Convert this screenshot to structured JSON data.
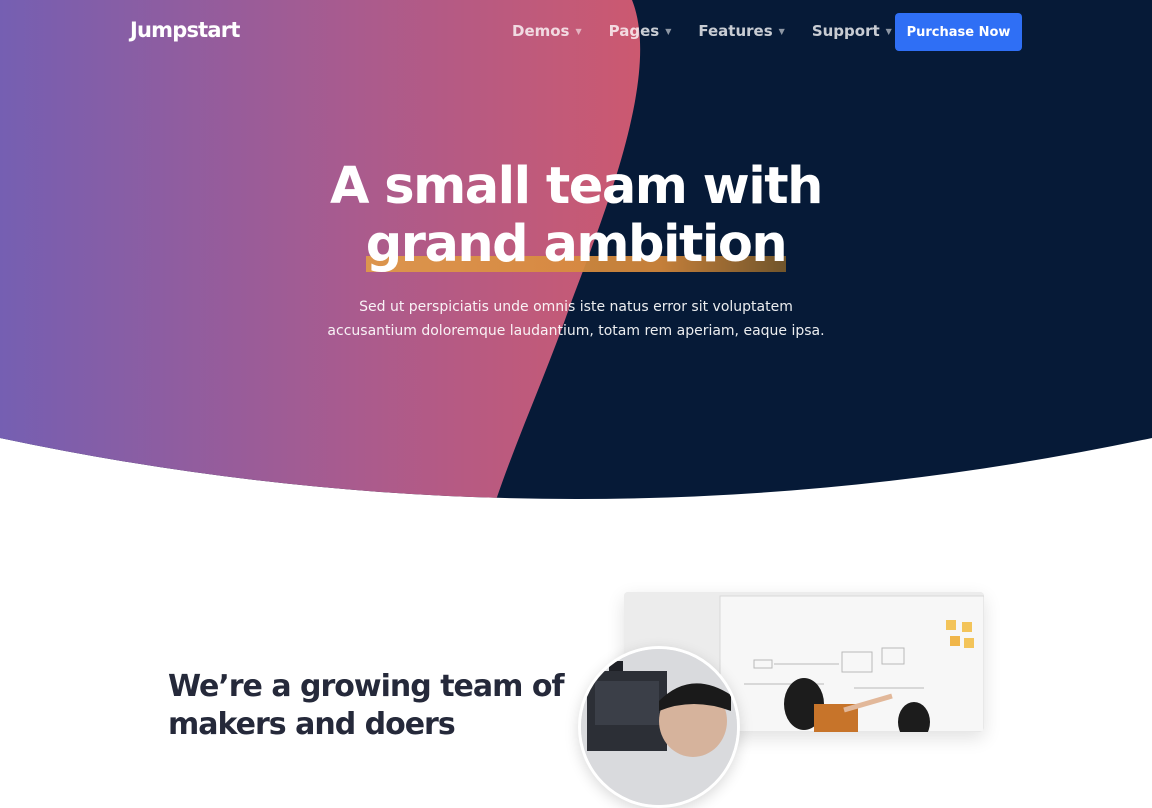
{
  "brand": {
    "name": "Jumpstart"
  },
  "nav": {
    "items": [
      {
        "label": "Demos"
      },
      {
        "label": "Pages"
      },
      {
        "label": "Features"
      },
      {
        "label": "Support"
      }
    ],
    "cta_label": "Purchase Now"
  },
  "hero": {
    "headline_line1": "A small team with",
    "headline_line2": "grand ambition",
    "subtitle": "Sed ut perspiciatis unde omnis iste natus error sit voluptatem accusantium doloremque laudantium, totam rem aperiam, eaque ipsa."
  },
  "about": {
    "title": "We’re a growing team of makers and doers"
  },
  "colors": {
    "navy": "#061a37",
    "gradient_start": "#7a5db0",
    "gradient_end": "#cf5a72",
    "cta": "#2f6ff5",
    "highlight": "#e09a48"
  }
}
